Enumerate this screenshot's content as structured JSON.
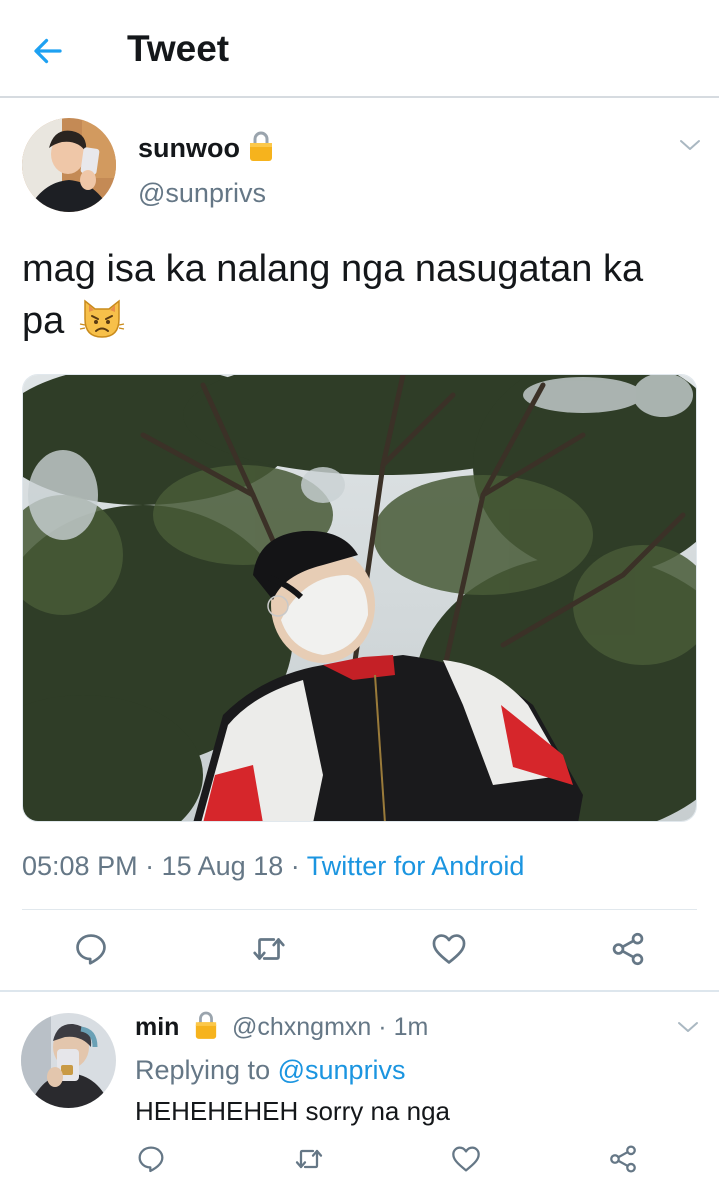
{
  "header": {
    "title": "Tweet",
    "back_icon": "arrow-left-icon"
  },
  "tweet": {
    "author_name": "sunwoo",
    "author_handle": "@sunprivs",
    "protected_icon": "lock-icon",
    "text": "mag isa ka nalang nga nasugatan ka pa",
    "emoji": "pouting-cat-face",
    "time": "05:08 PM",
    "separator": "·",
    "date": "15 Aug 18",
    "source": "Twitter for Android",
    "actions": [
      "reply-icon",
      "retweet-icon",
      "like-icon",
      "share-icon"
    ]
  },
  "reply": {
    "author_name": "min",
    "author_handle": "@chxngmxn",
    "time_ago": "1m",
    "replying_prefix": "Replying to",
    "replying_to": "@sunprivs",
    "text": "HEHEHEHEH sorry na nga",
    "actions": [
      "reply-icon",
      "retweet-icon",
      "like-icon",
      "share-icon"
    ]
  },
  "colors": {
    "accent": "#1b95e0",
    "text_primary": "#14171a",
    "text_secondary": "#657786",
    "divider": "#e1e8ed",
    "lock": "#f4b400"
  }
}
